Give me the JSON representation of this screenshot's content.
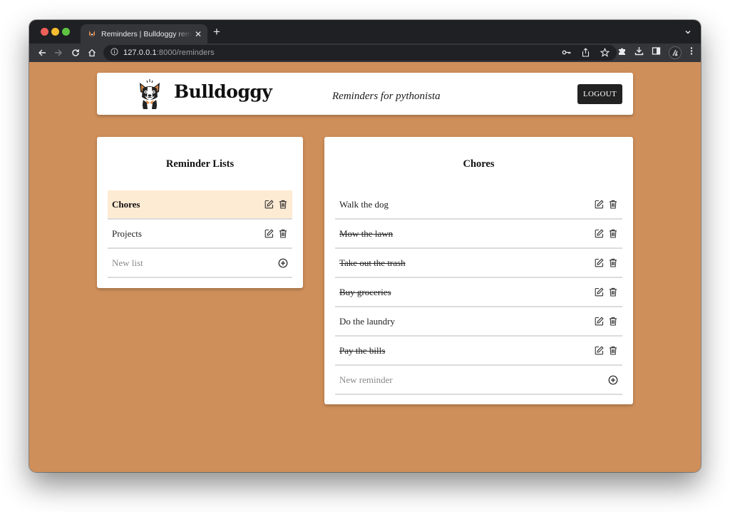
{
  "browser": {
    "tab": {
      "title": "Reminders | Bulldoggy reminders",
      "favicon": "bulldog-favicon"
    },
    "new_tab_label": "+",
    "address": {
      "host": "127.0.0.1",
      "rest": ":8000/reminders"
    },
    "icons": {
      "back": "arrow-left-icon",
      "forward": "arrow-right-icon",
      "reload": "reload-icon",
      "home": "home-icon",
      "info": "info-icon",
      "key": "key-icon",
      "share": "share-icon",
      "bookmark": "star-icon",
      "extensions": "puzzle-icon",
      "download": "download-icon",
      "sidepanel": "side-panel-icon",
      "profile": "profile-avatar",
      "menu": "kebab-menu-icon"
    }
  },
  "header": {
    "brand": "Bulldoggy",
    "tagline": "Reminders for pythonista",
    "logout_label": "LOGOUT"
  },
  "lists_panel": {
    "title": "Reminder Lists",
    "items": [
      {
        "label": "Chores",
        "active": true
      },
      {
        "label": "Projects",
        "active": false
      }
    ],
    "new_placeholder": "New list"
  },
  "reminders_panel": {
    "title": "Chores",
    "items": [
      {
        "label": "Walk the dog",
        "completed": false
      },
      {
        "label": "Mow the lawn",
        "completed": true
      },
      {
        "label": "Take out the trash",
        "completed": true
      },
      {
        "label": "Buy groceries",
        "completed": true
      },
      {
        "label": "Do the laundry",
        "completed": false
      },
      {
        "label": "Pay the bills",
        "completed": true
      }
    ],
    "new_placeholder": "New reminder"
  },
  "colors": {
    "page_background": "#cf8f5a",
    "active_row": "#fdebd3",
    "logout_button": "#222222"
  }
}
